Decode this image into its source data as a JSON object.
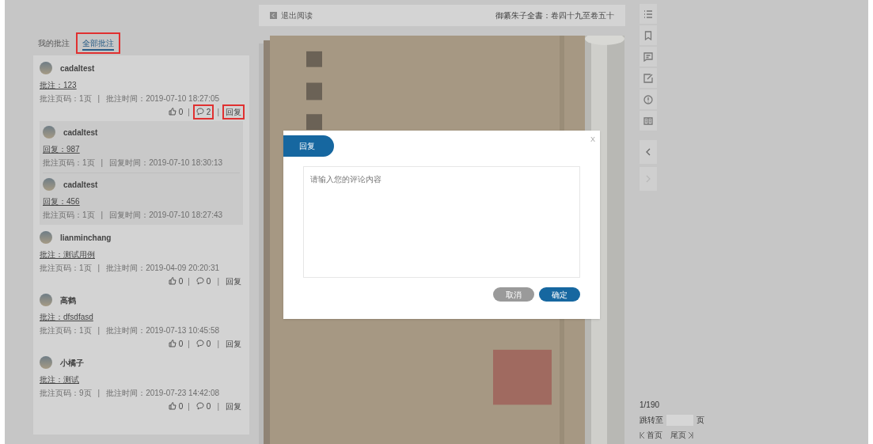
{
  "tabs": [
    {
      "label": "我的批注",
      "selected": false,
      "highlighted": false
    },
    {
      "label": "全部批注",
      "selected": true,
      "highlighted": true
    }
  ],
  "separator": "|",
  "annotations": [
    {
      "user": "cadaltest",
      "content": "批注：123",
      "page": "批注页码：1页",
      "time": "批注时间：2019-07-10 18:27:05",
      "likes": "0",
      "comments": "2",
      "reply": "回复",
      "highlighted": true,
      "replies": [
        {
          "user": "cadaltest",
          "content": "回复：987",
          "page": "批注页码：1页",
          "time": "回复时间：2019-07-10 18:30:13"
        },
        {
          "user": "cadaltest",
          "content": "回复：456",
          "page": "批注页码：1页",
          "time": "回复时间：2019-07-10 18:27:43"
        }
      ]
    },
    {
      "user": "lianminchang",
      "content": "批注：测试用例",
      "page": "批注页码：1页",
      "time": "批注时间：2019-04-09 20:20:31",
      "likes": "0",
      "comments": "0",
      "reply": "回复",
      "highlighted": false
    },
    {
      "user": "高鹤",
      "content": "批注：dfsdfasd",
      "page": "批注页码：1页",
      "time": "批注时间：2019-07-13 10:45:58",
      "likes": "0",
      "comments": "0",
      "reply": "回复",
      "highlighted": false
    },
    {
      "user": "小橘子",
      "content": "批注：测试",
      "page": "批注页码：9页",
      "time": "批注时间：2019-07-23 14:42:08",
      "likes": "0",
      "comments": "0",
      "reply": "回复",
      "highlighted": false
    }
  ],
  "reader": {
    "exit": "退出阅读",
    "title": "御纂朱子全書：卷四十九至卷五十"
  },
  "toolbar": [
    {
      "kind": "list"
    },
    {
      "kind": "bookmark"
    },
    {
      "kind": "comment"
    },
    {
      "kind": "edit"
    },
    {
      "kind": "alert"
    },
    {
      "kind": "book"
    }
  ],
  "nav": {
    "prev_disabled": false,
    "next_disabled": true
  },
  "pager": {
    "position": "1/190",
    "goto": "跳转至",
    "unit": "页",
    "first": "首页",
    "last": "尾页"
  },
  "dialog": {
    "tab": "回复",
    "close": "X",
    "placeholder": "请输入您的评论内容",
    "cancel": "取消",
    "confirm": "确定"
  }
}
